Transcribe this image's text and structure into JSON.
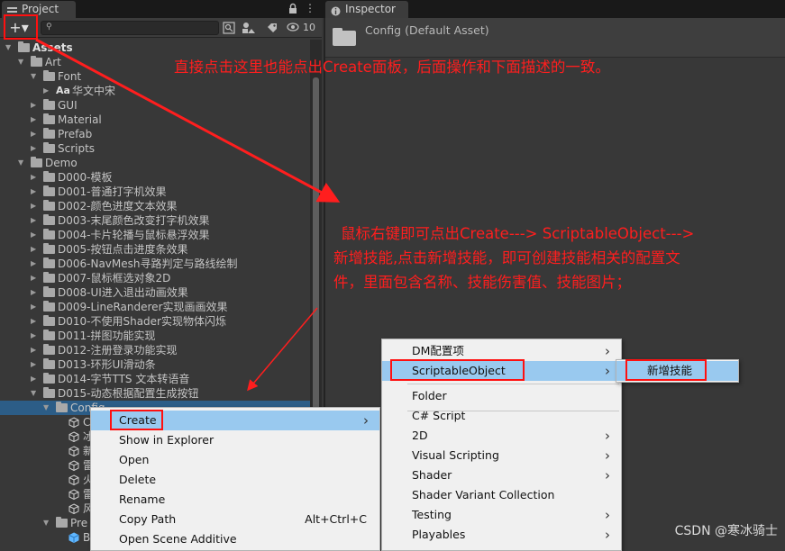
{
  "tabs": {
    "project": "Project",
    "inspector": "Inspector"
  },
  "toolbar": {
    "add_button": "+▾",
    "search_placeholder": "",
    "count": "10"
  },
  "tree": [
    {
      "label": "Assets",
      "depth": 0,
      "expanded": true,
      "bold": true,
      "kind": "folder"
    },
    {
      "label": "Art",
      "depth": 1,
      "expanded": true,
      "kind": "folder"
    },
    {
      "label": "Font",
      "depth": 2,
      "expanded": true,
      "kind": "folder"
    },
    {
      "label": "华文中宋",
      "depth": 3,
      "expanded": false,
      "kind": "font",
      "prefix": "Aa"
    },
    {
      "label": "GUI",
      "depth": 2,
      "expanded": false,
      "kind": "folder"
    },
    {
      "label": "Material",
      "depth": 2,
      "expanded": false,
      "kind": "folder"
    },
    {
      "label": "Prefab",
      "depth": 2,
      "expanded": false,
      "kind": "folder"
    },
    {
      "label": "Scripts",
      "depth": 2,
      "expanded": false,
      "kind": "folder"
    },
    {
      "label": "Demo",
      "depth": 1,
      "expanded": true,
      "kind": "folder"
    },
    {
      "label": "D000-模板",
      "depth": 2,
      "expanded": false,
      "kind": "folder"
    },
    {
      "label": "D001-普通打字机效果",
      "depth": 2,
      "expanded": false,
      "kind": "folder"
    },
    {
      "label": "D002-颜色进度文本效果",
      "depth": 2,
      "expanded": false,
      "kind": "folder"
    },
    {
      "label": "D003-末尾颜色改变打字机效果",
      "depth": 2,
      "expanded": false,
      "kind": "folder"
    },
    {
      "label": "D004-卡片轮播与鼠标悬浮效果",
      "depth": 2,
      "expanded": false,
      "kind": "folder"
    },
    {
      "label": "D005-按钮点击进度条效果",
      "depth": 2,
      "expanded": false,
      "kind": "folder"
    },
    {
      "label": "D006-NavMesh寻路判定与路线绘制",
      "depth": 2,
      "expanded": false,
      "kind": "folder"
    },
    {
      "label": "D007-鼠标框选对象2D",
      "depth": 2,
      "expanded": false,
      "kind": "folder"
    },
    {
      "label": "D008-UI进入退出动画效果",
      "depth": 2,
      "expanded": false,
      "kind": "folder"
    },
    {
      "label": "D009-LineRanderer实现画画效果",
      "depth": 2,
      "expanded": false,
      "kind": "folder"
    },
    {
      "label": "D010-不使用Shader实现物体闪烁",
      "depth": 2,
      "expanded": false,
      "kind": "folder"
    },
    {
      "label": "D011-拼图功能实现",
      "depth": 2,
      "expanded": false,
      "kind": "folder"
    },
    {
      "label": "D012-注册登录功能实现",
      "depth": 2,
      "expanded": false,
      "kind": "folder"
    },
    {
      "label": "D013-环形UI滑动条",
      "depth": 2,
      "expanded": false,
      "kind": "folder"
    },
    {
      "label": "D014-字节TTS 文本转语音",
      "depth": 2,
      "expanded": false,
      "kind": "folder"
    },
    {
      "label": "D015-动态根据配置生成按钮",
      "depth": 2,
      "expanded": true,
      "kind": "folder"
    },
    {
      "label": "Config",
      "depth": 3,
      "expanded": true,
      "kind": "folder",
      "selected": true
    },
    {
      "label": "C",
      "depth": 4,
      "kind": "asset"
    },
    {
      "label": "冰",
      "depth": 4,
      "kind": "asset"
    },
    {
      "label": "新",
      "depth": 4,
      "kind": "asset"
    },
    {
      "label": "雷",
      "depth": 4,
      "kind": "asset"
    },
    {
      "label": "火",
      "depth": 4,
      "kind": "asset"
    },
    {
      "label": "雷",
      "depth": 4,
      "kind": "asset"
    },
    {
      "label": "风",
      "depth": 4,
      "kind": "asset"
    },
    {
      "label": "Pre",
      "depth": 3,
      "expanded": true,
      "kind": "folder"
    },
    {
      "label": "B",
      "depth": 4,
      "kind": "prefab"
    }
  ],
  "inspector": {
    "title": "Config (Default Asset)"
  },
  "context_menu": {
    "items": [
      {
        "label": "Create",
        "shortcut": "",
        "submenu": true,
        "highlighted": true
      },
      {
        "label": "Show in Explorer",
        "shortcut": ""
      },
      {
        "label": "Open",
        "shortcut": ""
      },
      {
        "label": "Delete",
        "shortcut": ""
      },
      {
        "label": "Rename",
        "shortcut": ""
      },
      {
        "label": "Copy Path",
        "shortcut": "Alt+Ctrl+C"
      },
      {
        "label": "Open Scene Additive",
        "shortcut": ""
      }
    ]
  },
  "create_menu": {
    "items": [
      {
        "label": "DM配置项",
        "submenu": true
      },
      {
        "label": "ScriptableObject",
        "submenu": true,
        "highlighted": true
      },
      {
        "label": "Folder",
        "submenu": false
      },
      {
        "label": "C# Script",
        "submenu": false
      },
      {
        "label": "2D",
        "submenu": true
      },
      {
        "label": "Visual Scripting",
        "submenu": true
      },
      {
        "label": "Shader",
        "submenu": true
      },
      {
        "label": "Shader Variant Collection",
        "submenu": false
      },
      {
        "label": "Testing",
        "submenu": true
      },
      {
        "label": "Playables",
        "submenu": true
      }
    ]
  },
  "so_menu": {
    "items": [
      {
        "label": "新增技能",
        "highlighted": true
      }
    ]
  },
  "annotations": {
    "note1": "直接点击这里也能点出Create面板，后面操作和下面描述的一致。",
    "note2_line1": "鼠标右键即可点出Create---> ScriptableObject--->",
    "note2_line2": "新增技能,点击新增技能，即可创建技能相关的配置文",
    "note2_line3": "件，里面包含名称、技能伤害值、技能图片；"
  },
  "watermark": "CSDN @寒冰骑士",
  "colors": {
    "annotation_red": "#ff1e1e",
    "selection_blue": "#2c5d87",
    "menu_highlight": "#99c9ef"
  }
}
